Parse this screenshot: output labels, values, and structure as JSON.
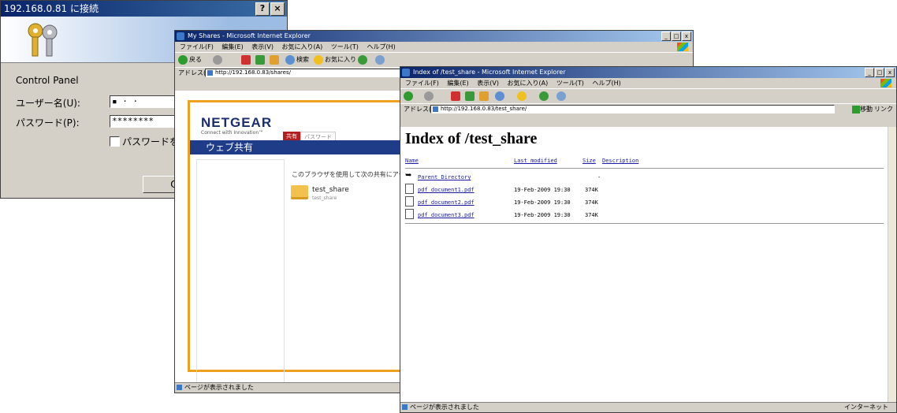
{
  "login_dialog": {
    "title": "192.168.0.81 に接続",
    "help_btn": "?",
    "close_btn": "×",
    "realm": "Control Panel",
    "username_label": "ユーザー名(U):",
    "username_value": "▪ · ·",
    "password_label": "パスワード(P):",
    "password_value": "********",
    "remember_label": "パスワードを記憶",
    "ok_label": "O"
  },
  "ie_common": {
    "menu": [
      "ファイル(F)",
      "編集(E)",
      "表示(V)",
      "お気に入り(A)",
      "ツール(T)",
      "ヘルプ(H)"
    ],
    "back": "戻る",
    "search": "検索",
    "favorites": "お気に入り",
    "address_label": "アドレス(D)",
    "go": "移動",
    "links": "リンク",
    "status_done": "ページが表示されました",
    "zone": "インターネット"
  },
  "shares_window": {
    "title": "My Shares - Microsoft Internet Explorer",
    "url": "http://192.168.0.83/shares/",
    "logo": "NETGEAR",
    "tagline": "Connect with Innovation™",
    "tab_active": "共有",
    "tab_inactive": "パスワード",
    "nav_title": "ウェブ共有",
    "description": "このブラウザを使用して次の共有にアク",
    "folder_name": "test_share",
    "folder_sub": "test_share"
  },
  "index_window": {
    "title": "Index of /test_share - Microsoft Internet Explorer",
    "url": "http://192.168.0.83/test_share/",
    "heading": "Index of /test_share",
    "headers": {
      "name": "Name",
      "modified": "Last modified",
      "size": "Size",
      "desc": "Description"
    },
    "parent": {
      "name": "Parent Directory",
      "size": "-"
    },
    "files": [
      {
        "name": "pdf_document1.pdf",
        "modified": "19-Feb-2009 19:30",
        "size": "374K"
      },
      {
        "name": "pdf_document2.pdf",
        "modified": "19-Feb-2009 19:30",
        "size": "374K"
      },
      {
        "name": "pdf_document3.pdf",
        "modified": "19-Feb-2009 19:30",
        "size": "374K"
      }
    ]
  }
}
